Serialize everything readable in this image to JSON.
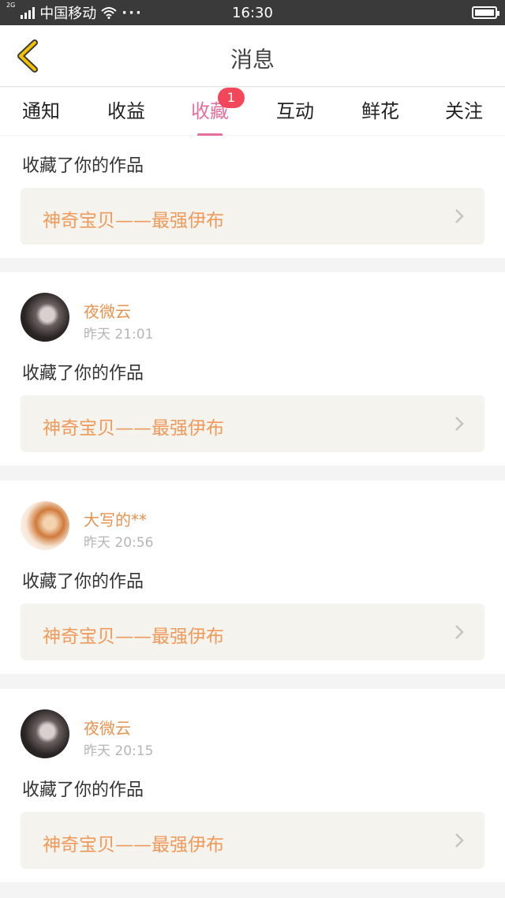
{
  "status_bar": {
    "network_tag": "2G",
    "carrier": "中国移动",
    "dots": "···",
    "time": "16:30"
  },
  "nav": {
    "title": "消息",
    "back_icon": "chevron-left-icon",
    "accent_color": "#f2c200"
  },
  "tabs": [
    {
      "label": "通知"
    },
    {
      "label": "收益"
    },
    {
      "label": "收藏",
      "badge": "1",
      "active": true
    },
    {
      "label": "互动"
    },
    {
      "label": "鲜花"
    },
    {
      "label": "关注"
    }
  ],
  "colors": {
    "active_tab": "#e46f9c",
    "badge": "#f2475a",
    "user_name": "#e7924e",
    "work_title": "#ef9a5a"
  },
  "feed": [
    {
      "action": "收藏了你的作品",
      "work_title": "神奇宝贝——最强伊布"
    },
    {
      "user": "夜微云",
      "time": "昨天 21:01",
      "action": "收藏了你的作品",
      "work_title": "神奇宝贝——最强伊布"
    },
    {
      "user": "大写的**",
      "time": "昨天 20:56",
      "action": "收藏了你的作品",
      "work_title": "神奇宝贝——最强伊布"
    },
    {
      "user": "夜微云",
      "time": "昨天 20:15",
      "action": "收藏了你的作品",
      "work_title": "神奇宝贝——最强伊布"
    }
  ]
}
